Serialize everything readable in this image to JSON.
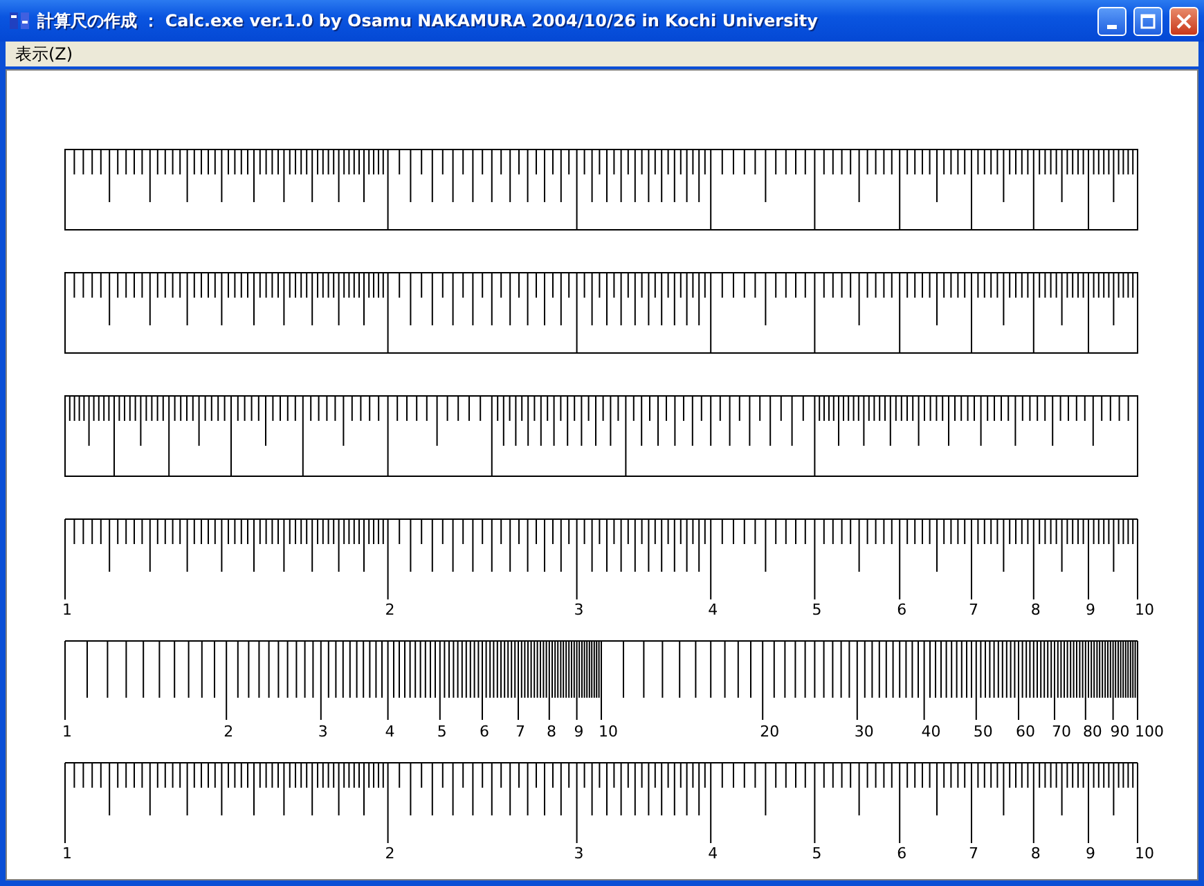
{
  "window": {
    "title": "計算尺の作成 ： Calc.exe ver.1.0 by Osamu NAKAMURA 2004/10/26 in Kochi University"
  },
  "menu": [
    "表示(Z)"
  ],
  "scales": [
    {
      "kind": "c-box"
    },
    {
      "kind": "c-box"
    },
    {
      "kind": "ci-box"
    },
    {
      "kind": "c",
      "labels": [
        "1",
        "2",
        "3",
        "4",
        "5",
        "6",
        "7",
        "8",
        "9",
        "10"
      ]
    },
    {
      "kind": "a",
      "labels": [
        "1",
        "2",
        "3",
        "4",
        "5",
        "6",
        "7",
        "8",
        "9",
        "10",
        "20",
        "30",
        "40",
        "50",
        "60",
        "70",
        "80",
        "90",
        "100"
      ]
    },
    {
      "kind": "c",
      "labels": [
        "1",
        "2",
        "3",
        "4",
        "5",
        "6",
        "7",
        "8",
        "9",
        "10"
      ]
    }
  ]
}
